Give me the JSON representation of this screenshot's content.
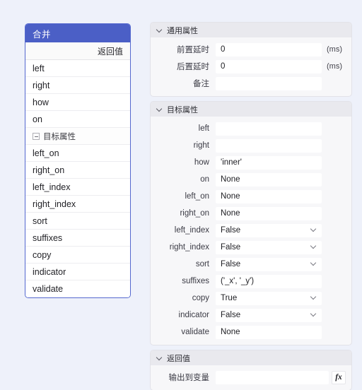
{
  "theme": {
    "background": "#eef1fa",
    "node_header_bg": "#4b5fc6",
    "node_border": "#5468cf",
    "section_head_bg": "#e9e9ee",
    "section_body_bg": "#f7f7f9"
  },
  "node_panel": {
    "title": "合并",
    "return_label": "返回值",
    "rows": [
      {
        "label": "left",
        "type": "port"
      },
      {
        "label": "right",
        "type": "port"
      },
      {
        "label": "how",
        "type": "port"
      },
      {
        "label": "on",
        "type": "port"
      },
      {
        "label": "目标属性",
        "type": "group",
        "icon": "collapse-minus-box-icon"
      },
      {
        "label": "left_on",
        "type": "port"
      },
      {
        "label": "right_on",
        "type": "port"
      },
      {
        "label": "left_index",
        "type": "port"
      },
      {
        "label": "right_index",
        "type": "port"
      },
      {
        "label": "sort",
        "type": "port"
      },
      {
        "label": "suffixes",
        "type": "port"
      },
      {
        "label": "copy",
        "type": "port"
      },
      {
        "label": "indicator",
        "type": "port"
      },
      {
        "label": "validate",
        "type": "port"
      }
    ]
  },
  "properties": {
    "sections": [
      {
        "title": "通用属性",
        "icon": "chevron-down-icon",
        "fields": [
          {
            "label": "前置延时",
            "value": "0",
            "unit": "(ms)",
            "control": "text"
          },
          {
            "label": "后置延时",
            "value": "0",
            "unit": "(ms)",
            "control": "text"
          },
          {
            "label": "备注",
            "value": "",
            "unit": "",
            "control": "text"
          }
        ]
      },
      {
        "title": "目标属性",
        "icon": "chevron-down-icon",
        "fields": [
          {
            "label": "left",
            "value": "",
            "unit": "",
            "control": "text"
          },
          {
            "label": "right",
            "value": "",
            "unit": "",
            "control": "text"
          },
          {
            "label": "how",
            "value": "'inner'",
            "unit": "",
            "control": "text"
          },
          {
            "label": "on",
            "value": "None",
            "unit": "",
            "control": "text"
          },
          {
            "label": "left_on",
            "value": "None",
            "unit": "",
            "control": "text"
          },
          {
            "label": "right_on",
            "value": "None",
            "unit": "",
            "control": "text"
          },
          {
            "label": "left_index",
            "value": "False",
            "unit": "",
            "control": "select"
          },
          {
            "label": "right_index",
            "value": "False",
            "unit": "",
            "control": "select"
          },
          {
            "label": "sort",
            "value": "False",
            "unit": "",
            "control": "select"
          },
          {
            "label": "suffixes",
            "value": "('_x', '_y')",
            "unit": "",
            "control": "text"
          },
          {
            "label": "copy",
            "value": "True",
            "unit": "",
            "control": "select"
          },
          {
            "label": "indicator",
            "value": "False",
            "unit": "",
            "control": "select"
          },
          {
            "label": "validate",
            "value": "None",
            "unit": "",
            "control": "text"
          }
        ]
      },
      {
        "title": "返回值",
        "icon": "chevron-down-icon",
        "fields": [
          {
            "label": "输出到变量",
            "value": "",
            "unit": "",
            "control": "fx"
          }
        ]
      }
    ],
    "fx_button_label": "fx"
  }
}
